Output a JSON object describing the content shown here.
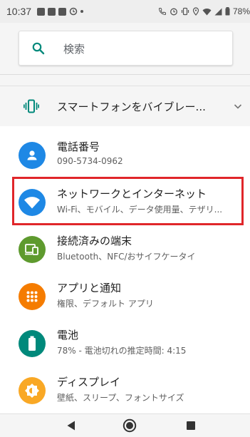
{
  "status_bar": {
    "time": "10:37",
    "battery": "78%"
  },
  "search": {
    "placeholder": "検索"
  },
  "suggestion": {
    "label": "スマートフォンをバイブレー...",
    "icon": "vibration-icon"
  },
  "settings": [
    {
      "title": "電話番号",
      "subtitle": "090-5734-0962",
      "icon": "person-icon",
      "color": "#1e88e5"
    },
    {
      "title": "ネットワークとインターネット",
      "subtitle": "Wi-Fi、モバイル、データ使用量、テザリ...",
      "icon": "wifi-icon",
      "color": "#1e88e5"
    },
    {
      "title": "接続済みの端末",
      "subtitle": "Bluetooth、NFC/おサイフケータイ",
      "icon": "devices-icon",
      "color": "#5e9a2e"
    },
    {
      "title": "アプリと通知",
      "subtitle": "権限、デフォルト アプリ",
      "icon": "apps-icon",
      "color": "#f57c00"
    },
    {
      "title": "電池",
      "subtitle": "78% - 電池切れの推定時間: 4:15",
      "icon": "battery-icon",
      "color": "#00897b"
    },
    {
      "title": "ディスプレイ",
      "subtitle": "壁紙、スリープ、フォントサイズ",
      "icon": "brightness-icon",
      "color": "#f9a825"
    }
  ],
  "colors": {
    "highlight": "#e0262a",
    "accent": "#00897b"
  }
}
